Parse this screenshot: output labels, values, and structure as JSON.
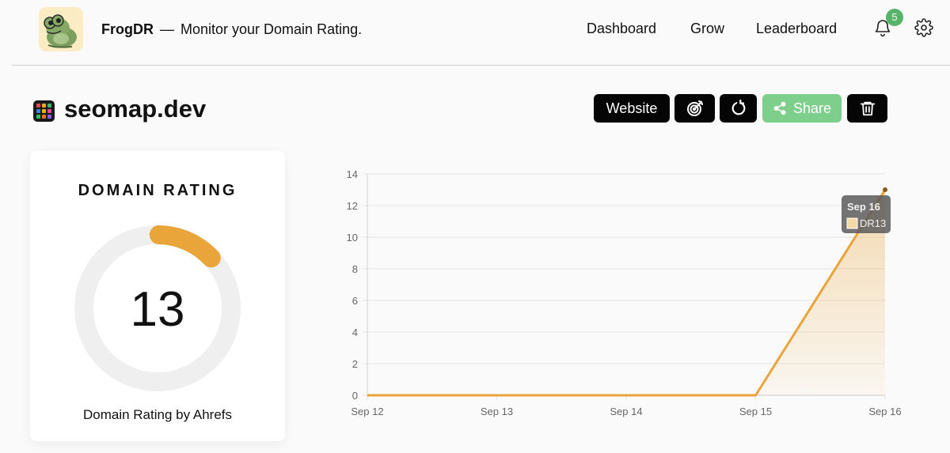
{
  "header": {
    "app_name": "FrogDR",
    "separator": "—",
    "tagline": "Monitor your Domain Rating.",
    "nav": [
      {
        "label": "Dashboard"
      },
      {
        "label": "Grow"
      },
      {
        "label": "Leaderboard"
      }
    ],
    "notification_count": "5",
    "icons": [
      "bell-icon",
      "gear-icon"
    ]
  },
  "site": {
    "title": "seomap.dev"
  },
  "toolbar": {
    "website_label": "Website",
    "share_label": "Share",
    "icons": [
      "target-icon",
      "refresh-icon",
      "share-icon",
      "trash-icon"
    ]
  },
  "rating_card": {
    "title": "DOMAIN RATING",
    "value": "13",
    "fraction": 0.13,
    "footer": "Domain Rating by Ahrefs"
  },
  "colors": {
    "accent": "#e9a43a",
    "share_green": "#7fcf8c",
    "badge_green": "#57b368",
    "button_black": "#050505",
    "track_gray": "#efefef"
  },
  "chart_data": {
    "type": "area",
    "categories": [
      "Sep 12",
      "Sep 13",
      "Sep 14",
      "Sep 15",
      "Sep 16"
    ],
    "series": [
      {
        "name": "DR",
        "values": [
          0,
          0,
          0,
          0,
          13
        ]
      }
    ],
    "ylim": [
      0,
      14
    ],
    "yticks": [
      0,
      2,
      4,
      6,
      8,
      10,
      12,
      14
    ],
    "grid": true,
    "tooltip": {
      "title": "Sep 16",
      "label": "DR13"
    }
  }
}
